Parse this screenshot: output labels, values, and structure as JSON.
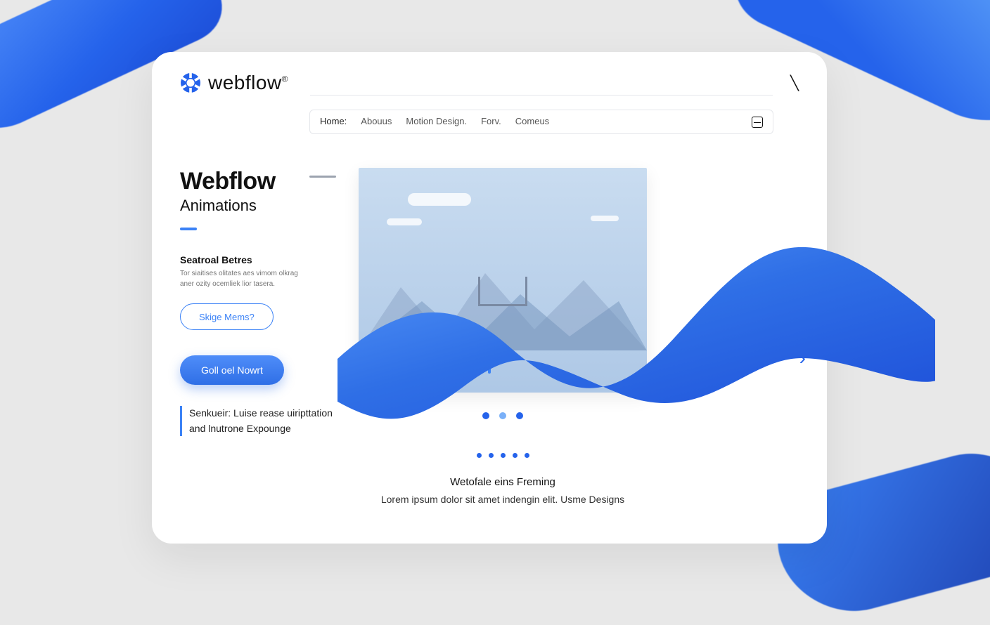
{
  "brand": {
    "name": "webflow",
    "trademark": "®"
  },
  "nav": {
    "items": [
      "Home:",
      "Abouus",
      "Motion Design.",
      "Forv.",
      "Comeus"
    ]
  },
  "hero": {
    "title": "Webflow",
    "subtitle": "Animations",
    "section_heading": "Seatroal Betres",
    "section_desc": "Tor siaitises olitates aes vimom olkrag aner ozity ocemliek lior tasera.",
    "outline_button": "Skige Mems?",
    "primary_button": "Goll oel Nowrt",
    "tagline": "Senkueir: Luise rease uiripttation and lnutrone Expounge"
  },
  "footer": {
    "heading": "Wetofale eins Freming",
    "body": "Lorem ipsum dolor sit amet indengin elit. Usme Designs"
  },
  "colors": {
    "primary": "#2563eb"
  }
}
